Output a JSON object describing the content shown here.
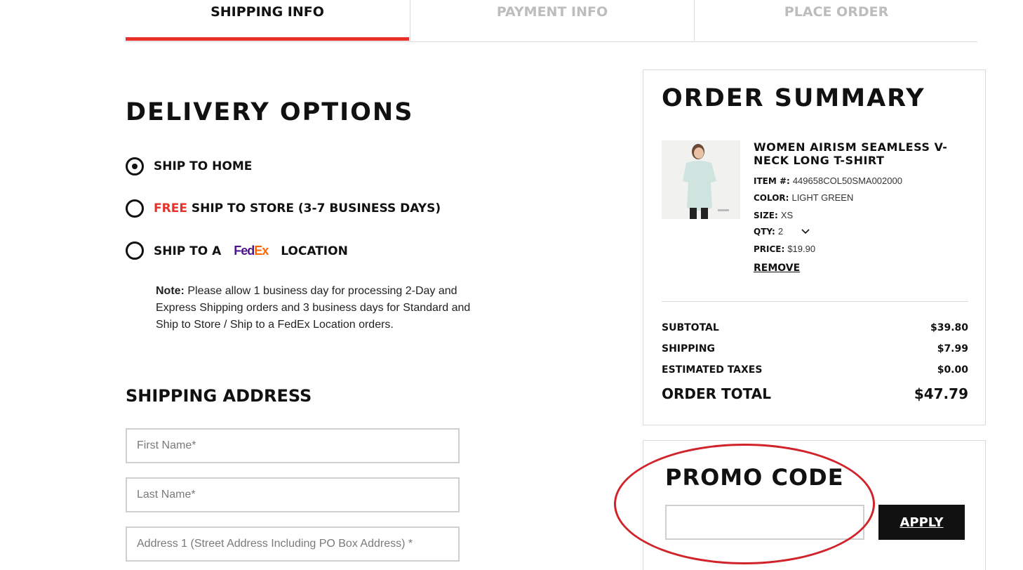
{
  "steps": [
    {
      "label": "SHIPPING INFO",
      "active": true
    },
    {
      "label": "PAYMENT INFO",
      "active": false
    },
    {
      "label": "PLACE ORDER",
      "active": false
    }
  ],
  "delivery": {
    "title": "DELIVERY OPTIONS",
    "options": [
      {
        "label": "SHIP TO HOME",
        "selected": true
      },
      {
        "prefix": "FREE",
        "label": "SHIP TO STORE (3-7 BUSINESS DAYS)",
        "selected": false
      },
      {
        "label_before": "SHIP TO A",
        "brand": "FedEx",
        "brand_part1": "Fed",
        "brand_part2": "Ex",
        "label_after": "LOCATION",
        "selected": false
      }
    ],
    "note_label": "Note:",
    "note_text": "Please allow 1 business day for processing 2-Day and Express Shipping orders and 3 business days for Standard and Ship to Store / Ship to a FedEx Location orders."
  },
  "shipping_address": {
    "title": "SHIPPING ADDRESS",
    "fields": [
      {
        "placeholder": "First Name*",
        "value": ""
      },
      {
        "placeholder": "Last Name*",
        "value": ""
      },
      {
        "placeholder": "Address 1 (Street Address Including PO Box Address) *",
        "value": ""
      }
    ]
  },
  "summary": {
    "title": "ORDER SUMMARY",
    "product": {
      "name": "WOMEN AIRISM SEAMLESS V-NECK LONG T-SHIRT",
      "item_label": "ITEM #:",
      "item_value": "449658COL50SMA002000",
      "color_label": "COLOR:",
      "color_value": "LIGHT GREEN",
      "size_label": "SIZE:",
      "size_value": "XS",
      "qty_label": "QTY:",
      "qty_value": "2",
      "price_label": "PRICE:",
      "price_value": "$19.90",
      "remove_label": "REMOVE"
    },
    "subtotal_label": "SUBTOTAL",
    "subtotal_value": "$39.80",
    "shipping_label": "SHIPPING",
    "shipping_value": "$7.99",
    "taxes_label": "ESTIMATED TAXES",
    "taxes_value": "$0.00",
    "total_label": "ORDER TOTAL",
    "total_value": "$47.79"
  },
  "promo": {
    "title": "PROMO CODE",
    "value": "",
    "apply_label": "APPLY"
  },
  "colors": {
    "accent_red": "#e8312a",
    "annotation_red": "#d0232a",
    "fedex_purple": "#4d148c",
    "fedex_orange": "#ff6600"
  },
  "icons": {
    "qty_dropdown": "chevron-down-icon",
    "radio_selected": "radio-checked-icon",
    "radio_unselected": "radio-unchecked-icon"
  }
}
